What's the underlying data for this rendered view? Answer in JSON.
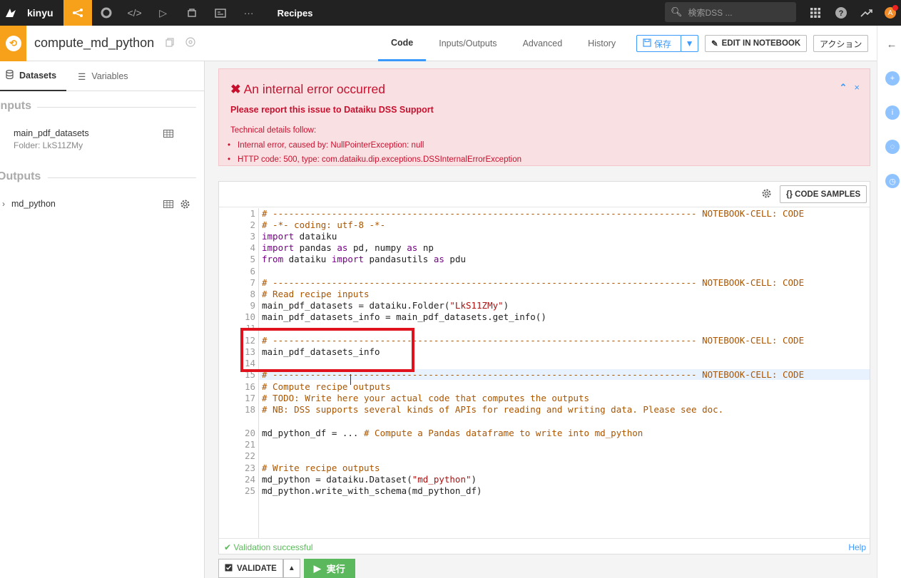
{
  "nav": {
    "project": "kinyu",
    "section": "Recipes",
    "search_placeholder": "検索DSS ...",
    "avatar_letter": "A"
  },
  "header": {
    "recipe_name": "compute_md_python",
    "tabs": [
      "Code",
      "Inputs/Outputs",
      "Advanced",
      "History"
    ],
    "save_label": "保存",
    "notebook_label": "EDIT IN NOTEBOOK",
    "actions_label": "アクション"
  },
  "left": {
    "tabs": [
      "Datasets",
      "Variables"
    ],
    "inputs_title": "Inputs",
    "input_name": "main_pdf_datasets",
    "input_sub": "Folder: LkS11ZMy",
    "outputs_title": "Outputs",
    "output_name": "md_python"
  },
  "alert": {
    "title": "An internal error occurred",
    "subtitle": "Please report this issue to Dataiku DSS Support",
    "tech": "Technical details follow:",
    "items": [
      "Internal error, caused by: NullPointerException: null",
      "HTTP code: 500, type: com.dataiku.dip.exceptions.DSSInternalErrorException"
    ]
  },
  "editor": {
    "code_samples_label": "{} CODE SAMPLES",
    "status": "Validation successful",
    "help": "Help"
  },
  "bottom": {
    "validate_label": "VALIDATE",
    "run_label": "実行"
  },
  "colors": {
    "accent": "#f7a11a",
    "link": "#3b99fc",
    "error": "#c8102e",
    "success": "#5cb85c"
  }
}
